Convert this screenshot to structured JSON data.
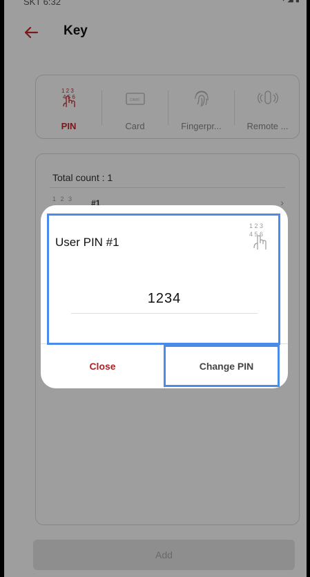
{
  "status_bar": {
    "time": "SKT 6:32",
    "icons": "▾ ◢ ▮"
  },
  "app_bar": {
    "title": "Key"
  },
  "tabs": [
    {
      "label": "PIN",
      "active": true,
      "icon": "pin-keypad-icon"
    },
    {
      "label": "Card",
      "active": false,
      "icon": "card-icon"
    },
    {
      "label": "Fingerpr...",
      "active": false,
      "icon": "fingerprint-icon"
    },
    {
      "label": "Remote ...",
      "active": false,
      "icon": "remote-icon"
    }
  ],
  "list": {
    "total_count": "Total count : 1",
    "items": [
      {
        "icon_text": "1 2 3",
        "label": "#1"
      }
    ]
  },
  "add_button": {
    "label": "Add"
  },
  "dialog": {
    "title": "User PIN #1",
    "pin": "1234",
    "close_label": "Close",
    "change_label": "Change PIN",
    "pin_icon_digits_top": "1 2 3",
    "pin_icon_digits_bottom": "4 5 6"
  },
  "colors": {
    "accent": "#c0282d",
    "highlight": "#4a8ae8"
  }
}
